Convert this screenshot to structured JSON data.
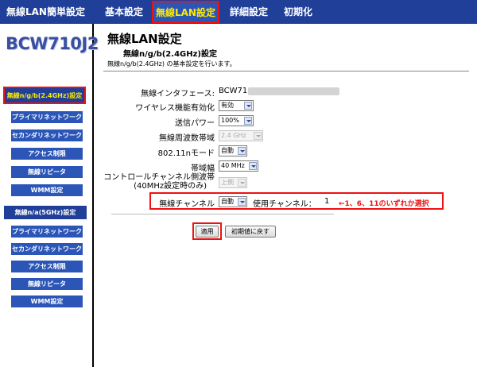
{
  "nav": {
    "items": [
      "無線LAN簡単設定",
      "基本設定",
      "無線LAN設定",
      "詳細設定",
      "初期化"
    ],
    "active_index": 2
  },
  "sidebar": {
    "logo": "BCW710J2",
    "group1": {
      "header": "無線n/g/b(2.4GHz)設定",
      "items": [
        "プライマリネットワーク",
        "セカンダリネットワーク",
        "アクセス制限",
        "無線リピータ",
        "WMM設定"
      ]
    },
    "group2": {
      "header": "無線n/a(5GHz)設定",
      "items": [
        "プライマリネットワーク",
        "セカンダリネットワーク",
        "アクセス制限",
        "無線リピータ",
        "WMM設定"
      ]
    }
  },
  "main": {
    "title": "無線LAN設定",
    "subtitle": "無線n/g/b(2.4GHz)設定",
    "description": "無線n/g/b(2.4GHz) の基本設定を行います。",
    "fields": {
      "interface": {
        "label": "無線インタフェース:",
        "value": "BCW710J-"
      },
      "enable": {
        "label": "ワイヤレス機能有効化",
        "value": "有効"
      },
      "power": {
        "label": "送信パワー",
        "value": "100%"
      },
      "band": {
        "label": "無線周波数帯域",
        "value": "2.4 GHz"
      },
      "mode": {
        "label": "802.11nモード",
        "value": "自動"
      },
      "bandwidth": {
        "label": "帯域幅",
        "value": "40 MHz"
      },
      "sideband": {
        "label_line1": "コントロールチャンネル側波帯",
        "label_line2": "(40MHz設定時のみ)",
        "value": "上側"
      },
      "channel": {
        "label": "無線チャンネル",
        "value": "自動",
        "used_label": "使用チャンネル：",
        "used_value": "1",
        "note": "←1、6、11のいずれか選択"
      }
    },
    "buttons": {
      "apply": "適用",
      "reset": "初期値に戻す"
    }
  },
  "colors": {
    "nav_bg": "#1f3f98",
    "nav_active_text": "#ffea00",
    "highlight": "#ee1111",
    "sub_item_bg": "#2b56b8"
  }
}
